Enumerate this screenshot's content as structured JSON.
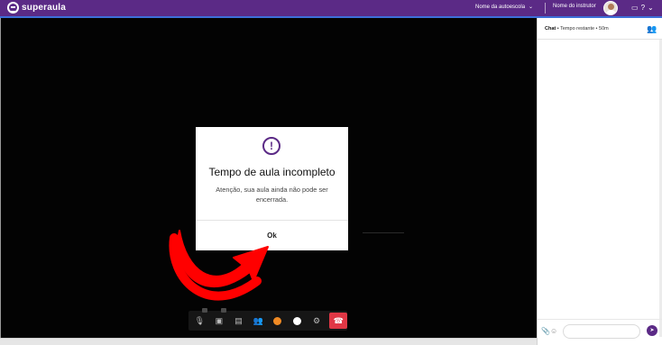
{
  "app": {
    "brand": "superaula"
  },
  "topbar": {
    "school_label": "Nome da autoescola",
    "instructor_label": "Nome do instrutor",
    "accent_color": "#5b2a86",
    "icons": [
      "screen-icon",
      "help-icon",
      "chevron-down-icon"
    ]
  },
  "modal": {
    "icon": "exclamation-icon",
    "title": "Tempo de aula incompleto",
    "message": "Atenção, sua aula ainda não pode ser encerrada.",
    "ok_label": "Ok"
  },
  "controls": {
    "buttons": [
      "mic-icon",
      "camera-icon",
      "screen-share-icon",
      "participants-icon",
      "reaction-icon",
      "record-icon",
      "settings-icon"
    ],
    "end_call_color": "#e03745"
  },
  "chat": {
    "title": "Chat",
    "subtitle": " • Tempo restante • 50m",
    "input_placeholder": ""
  }
}
